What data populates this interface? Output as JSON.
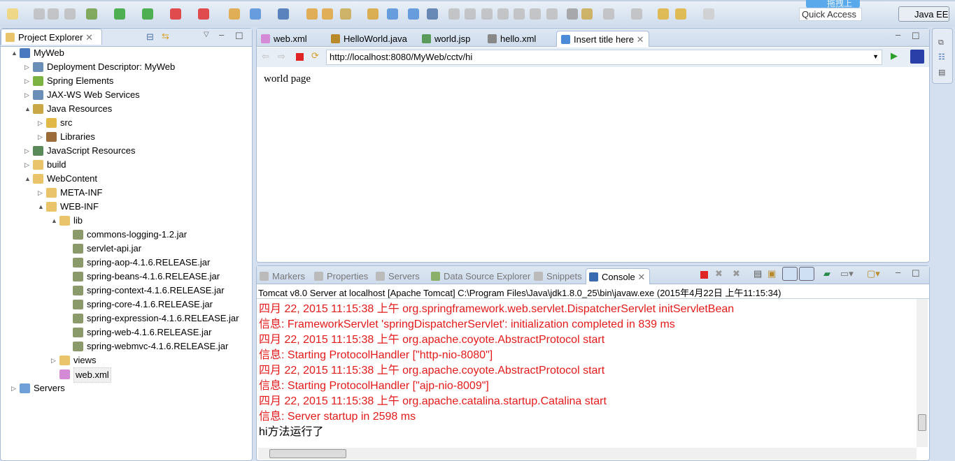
{
  "toolbar": {
    "quick_access": "Quick Access",
    "perspective": "Java EE",
    "upload_overlay": "拖拽上传"
  },
  "project_explorer": {
    "title": "Project Explorer",
    "tree": [
      {
        "label": "MyWeb",
        "level": 0,
        "toggle": "▲",
        "icon": "web-project-icon",
        "color": "#4a79c0"
      },
      {
        "label": "Deployment Descriptor: MyWeb",
        "level": 1,
        "toggle": "▷",
        "icon": "deployment-descriptor-icon",
        "color": "#6c8fb8"
      },
      {
        "label": "Spring Elements",
        "level": 1,
        "toggle": "▷",
        "icon": "spring-leaf-icon",
        "color": "#7cb342"
      },
      {
        "label": "JAX-WS Web Services",
        "level": 1,
        "toggle": "▷",
        "icon": "web-services-icon",
        "color": "#6c8fb8"
      },
      {
        "label": "Java Resources",
        "level": 1,
        "toggle": "▲",
        "icon": "java-resources-icon",
        "color": "#c9a646"
      },
      {
        "label": "src",
        "level": 2,
        "toggle": "▷",
        "icon": "source-folder-icon",
        "color": "#e2b846"
      },
      {
        "label": "Libraries",
        "level": 2,
        "toggle": "▷",
        "icon": "libraries-icon",
        "color": "#9c6b3a"
      },
      {
        "label": "JavaScript Resources",
        "level": 1,
        "toggle": "▷",
        "icon": "javascript-resources-icon",
        "color": "#5a8a5a"
      },
      {
        "label": "build",
        "level": 1,
        "toggle": "▷",
        "icon": "folder-icon",
        "color": "#e9c46a"
      },
      {
        "label": "WebContent",
        "level": 1,
        "toggle": "▲",
        "icon": "folder-icon",
        "color": "#e9c46a"
      },
      {
        "label": "META-INF",
        "level": 2,
        "toggle": "▷",
        "icon": "folder-icon",
        "color": "#e9c46a"
      },
      {
        "label": "WEB-INF",
        "level": 2,
        "toggle": "▲",
        "icon": "folder-icon",
        "color": "#e9c46a"
      },
      {
        "label": "lib",
        "level": 3,
        "toggle": "▲",
        "icon": "folder-icon",
        "color": "#e9c46a"
      },
      {
        "label": "commons-logging-1.2.jar",
        "level": 4,
        "toggle": "",
        "icon": "jar-icon",
        "color": "#8a9a6a"
      },
      {
        "label": "servlet-api.jar",
        "level": 4,
        "toggle": "",
        "icon": "jar-icon",
        "color": "#8a9a6a"
      },
      {
        "label": "spring-aop-4.1.6.RELEASE.jar",
        "level": 4,
        "toggle": "",
        "icon": "jar-icon",
        "color": "#8a9a6a"
      },
      {
        "label": "spring-beans-4.1.6.RELEASE.jar",
        "level": 4,
        "toggle": "",
        "icon": "jar-icon",
        "color": "#8a9a6a"
      },
      {
        "label": "spring-context-4.1.6.RELEASE.jar",
        "level": 4,
        "toggle": "",
        "icon": "jar-icon",
        "color": "#8a9a6a"
      },
      {
        "label": "spring-core-4.1.6.RELEASE.jar",
        "level": 4,
        "toggle": "",
        "icon": "jar-icon",
        "color": "#8a9a6a"
      },
      {
        "label": "spring-expression-4.1.6.RELEASE.jar",
        "level": 4,
        "toggle": "",
        "icon": "jar-icon",
        "color": "#8a9a6a"
      },
      {
        "label": "spring-web-4.1.6.RELEASE.jar",
        "level": 4,
        "toggle": "",
        "icon": "jar-icon",
        "color": "#8a9a6a"
      },
      {
        "label": "spring-webmvc-4.1.6.RELEASE.jar",
        "level": 4,
        "toggle": "",
        "icon": "jar-icon",
        "color": "#8a9a6a"
      },
      {
        "label": "views",
        "level": 3,
        "toggle": "▷",
        "icon": "folder-icon",
        "color": "#e9c46a"
      },
      {
        "label": "web.xml",
        "level": 3,
        "toggle": "",
        "icon": "xml-file-icon",
        "color": "#d58ad5",
        "selected": true
      },
      {
        "label": "Servers",
        "level": 0,
        "toggle": "▷",
        "icon": "folder-icon",
        "color": "#6fa0d8"
      }
    ]
  },
  "editor": {
    "tabs": [
      {
        "label": "web.xml",
        "icon": "xml-file-icon",
        "color": "#d58ad5"
      },
      {
        "label": "HelloWorld.java",
        "icon": "java-file-icon",
        "color": "#b88a2a"
      },
      {
        "label": "world.jsp",
        "icon": "jsp-file-icon",
        "color": "#5a9a5a"
      },
      {
        "label": "hello.xml",
        "icon": "xml-file-icon",
        "color": "#888"
      },
      {
        "label": "Insert title here",
        "icon": "globe-icon",
        "color": "#4a8ad8",
        "active": true
      }
    ],
    "url": "http://localhost:8080/MyWeb/cctv/hi",
    "page_text": "world page"
  },
  "console": {
    "tabs": [
      "Markers",
      "Properties",
      "Servers",
      "Data Source Explorer",
      "Snippets",
      "Console"
    ],
    "header": "Tomcat v8.0 Server at localhost [Apache Tomcat] C:\\Program Files\\Java\\jdk1.8.0_25\\bin\\javaw.exe (2015年4月22日 上午11:15:34)",
    "lines": [
      {
        "text": "四月 22, 2015 11:15:38 上午 org.springframework.web.servlet.DispatcherServlet initServletBean",
        "color": "#e41a1a"
      },
      {
        "text": "信息: FrameworkServlet 'springDispatcherServlet': initialization completed in 839 ms",
        "color": "#e41a1a"
      },
      {
        "text": "四月 22, 2015 11:15:38 上午 org.apache.coyote.AbstractProtocol start",
        "color": "#e41a1a"
      },
      {
        "text": "信息: Starting ProtocolHandler [\"http-nio-8080\"]",
        "color": "#e41a1a"
      },
      {
        "text": "四月 22, 2015 11:15:38 上午 org.apache.coyote.AbstractProtocol start",
        "color": "#e41a1a"
      },
      {
        "text": "信息: Starting ProtocolHandler [\"ajp-nio-8009\"]",
        "color": "#e41a1a"
      },
      {
        "text": "四月 22, 2015 11:15:38 上午 org.apache.catalina.startup.Catalina start",
        "color": "#e41a1a"
      },
      {
        "text": "信息: Server startup in 2598 ms",
        "color": "#e41a1a"
      },
      {
        "text": "hi方法运行了",
        "color": "#000000"
      }
    ]
  }
}
